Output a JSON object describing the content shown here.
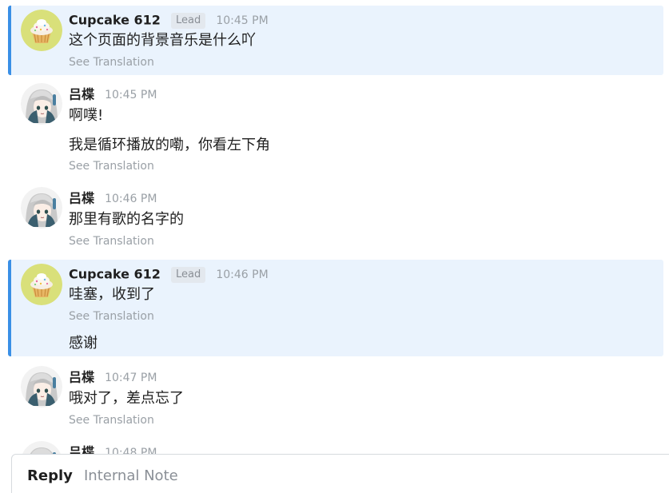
{
  "see_translation_label": "See Translation",
  "lead_badge_label": "Lead",
  "colors": {
    "lead_background": "#eaf3fd",
    "lead_accent_bar": "#3a8fe6",
    "cupcake_avatar_bg": "#d9e07a"
  },
  "messages": [
    {
      "author": "Cupcake 612",
      "badge": "Lead",
      "time": "10:45 PM",
      "avatar_icon": "cupcake-avatar-icon",
      "lines": [
        "这个页面的背景音乐是什么吖"
      ]
    },
    {
      "author": "吕楪",
      "time": "10:45 PM",
      "avatar_icon": "anime-girl-avatar-icon",
      "lines": [
        "啊噗!",
        "我是循环播放的嘞，你看左下角"
      ]
    },
    {
      "author": "吕楪",
      "time": "10:46 PM",
      "avatar_icon": "anime-girl-avatar-icon",
      "lines": [
        "那里有歌的名字的"
      ]
    },
    {
      "author": "Cupcake 612",
      "badge": "Lead",
      "time": "10:46 PM",
      "avatar_icon": "cupcake-avatar-icon",
      "lines": [
        "哇塞，收到了",
        "感谢"
      ]
    },
    {
      "author": "吕楪",
      "time": "10:47 PM",
      "avatar_icon": "anime-girl-avatar-icon",
      "lines": [
        "哦对了，差点忘了"
      ]
    },
    {
      "author": "吕楪",
      "time": "10:48 PM",
      "avatar_icon": "anime-girl-avatar-icon",
      "lines": []
    }
  ],
  "composer": {
    "tabs": [
      {
        "label": "Reply",
        "active": true
      },
      {
        "label": "Internal Note",
        "active": false
      }
    ]
  }
}
